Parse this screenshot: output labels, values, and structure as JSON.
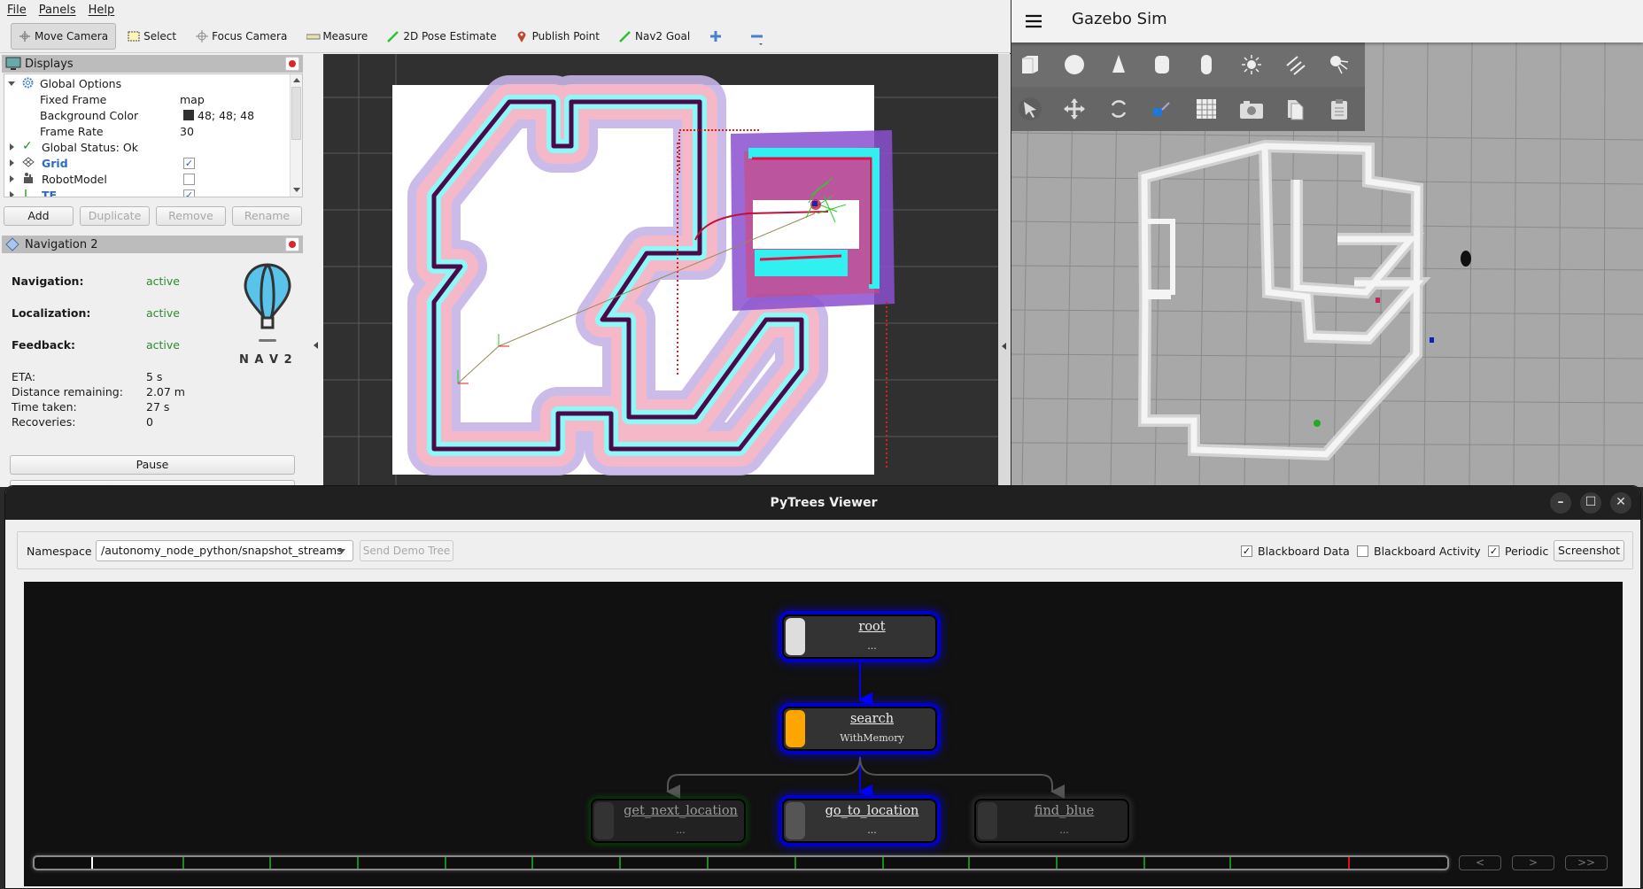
{
  "rviz": {
    "menu": [
      "File",
      "Panels",
      "Help"
    ],
    "toolbar": [
      {
        "label": "Move Camera",
        "icon": "move-camera-icon",
        "active": true
      },
      {
        "label": "Select",
        "icon": "select-icon"
      },
      {
        "label": "Focus Camera",
        "icon": "focus-camera-icon"
      },
      {
        "label": "Measure",
        "icon": "ruler-icon"
      },
      {
        "label": "2D Pose Estimate",
        "icon": "green-arrow-icon"
      },
      {
        "label": "Publish Point",
        "icon": "map-pin-icon"
      },
      {
        "label": "Nav2 Goal",
        "icon": "green-arrow-icon"
      }
    ],
    "displays": {
      "title": "Displays",
      "items": [
        {
          "label": "Global Options",
          "expanded": true
        },
        {
          "label": "Fixed Frame",
          "value": "map"
        },
        {
          "label": "Background Color",
          "value": "48; 48; 48",
          "swatch": "#303030"
        },
        {
          "label": "Frame Rate",
          "value": "30"
        },
        {
          "label": "Global Status: Ok"
        },
        {
          "label": "Grid",
          "checked": true
        },
        {
          "label": "RobotModel",
          "checked": false
        },
        {
          "label": "TF",
          "checked": true
        }
      ],
      "buttons": {
        "add": "Add",
        "duplicate": "Duplicate",
        "remove": "Remove",
        "rename": "Rename"
      }
    },
    "nav2": {
      "title": "Navigation 2",
      "status": [
        {
          "label": "Navigation:",
          "value": "active"
        },
        {
          "label": "Localization:",
          "value": "active"
        },
        {
          "label": "Feedback:",
          "value": "active"
        }
      ],
      "metrics": [
        {
          "label": "ETA:",
          "value": "5 s"
        },
        {
          "label": "Distance remaining:",
          "value": "2.07 m"
        },
        {
          "label": "Time taken:",
          "value": "27 s"
        },
        {
          "label": "Recoveries:",
          "value": "0"
        }
      ],
      "logo_text": "N A V 2",
      "pause_label": "Pause"
    }
  },
  "gazebo": {
    "title": "Gazebo Sim",
    "shapes_toolbar": [
      "box-icon",
      "sphere-icon",
      "cone-icon",
      "cylinder-icon",
      "capsule-icon",
      "point-light-icon",
      "directional-light-icon",
      "spot-light-icon"
    ],
    "tools_toolbar": [
      "select-arrow-icon",
      "translate-icon",
      "rotate-icon",
      "transform-control-icon",
      "grid-snap-icon",
      "camera-icon",
      "copy-icon",
      "paste-icon"
    ]
  },
  "pytrees": {
    "window_title": "PyTrees Viewer",
    "namespace_label": "Namespace",
    "namespace_value": "/autonomy_node_python/snapshot_streams",
    "send_demo_label": "Send Demo Tree",
    "checkboxes": [
      {
        "label": "Blackboard Data",
        "checked": true
      },
      {
        "label": "Blackboard Activity",
        "checked": false
      },
      {
        "label": "Periodic",
        "checked": true
      }
    ],
    "screenshot_label": "Screenshot",
    "tree": {
      "nodes": [
        {
          "id": "root",
          "name": "root",
          "detail": "...",
          "status_color": "#dddddd",
          "active": true
        },
        {
          "id": "search",
          "name": "search",
          "detail": "WithMemory",
          "status_color": "#ffa500",
          "active": true
        },
        {
          "id": "get_next_location",
          "name": "get_next_location",
          "detail": "...",
          "status": "success"
        },
        {
          "id": "go_to_location",
          "name": "go_to_location",
          "detail": "...",
          "status": "running",
          "active": true
        },
        {
          "id": "find_blue",
          "name": "find_blue",
          "detail": "...",
          "status": "idle"
        }
      ]
    },
    "timeline": {
      "nav_buttons": [
        "<",
        ">",
        ">>"
      ],
      "current_marker": 0.04,
      "success_ticks": [
        0.105,
        0.166,
        0.228,
        0.29,
        0.352,
        0.414,
        0.476,
        0.538,
        0.6,
        0.661,
        0.723,
        0.785,
        0.846
      ],
      "failure_ticks": [
        0.93
      ]
    }
  }
}
